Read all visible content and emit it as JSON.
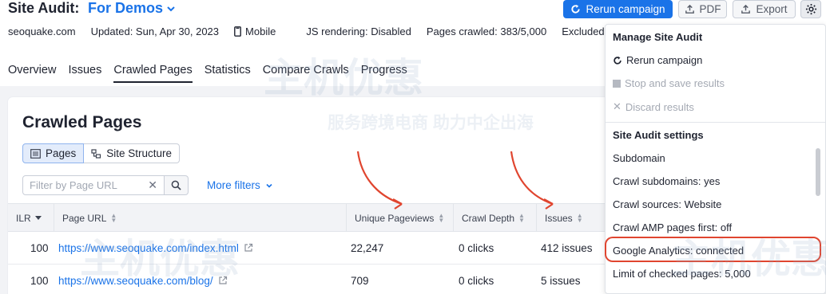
{
  "header": {
    "title": "Site Audit:",
    "project": "For Demos",
    "rerun_label": "Rerun campaign",
    "pdf_label": "PDF",
    "export_label": "Export"
  },
  "meta": {
    "domain": "seoquake.com",
    "updated": "Updated: Sun, Apr 30, 2023",
    "device": "Mobile",
    "js_rendering": "JS rendering: Disabled",
    "pages_crawled": "Pages crawled: 383/5,000",
    "excluded": "Excluded"
  },
  "tabs": [
    {
      "label": "Overview"
    },
    {
      "label": "Issues"
    },
    {
      "label": "Crawled Pages"
    },
    {
      "label": "Statistics"
    },
    {
      "label": "Compare Crawls"
    },
    {
      "label": "Progress"
    }
  ],
  "panel": {
    "title": "Crawled Pages",
    "seg_pages": "Pages",
    "seg_structure": "Site Structure",
    "filter_placeholder": "Filter by Page URL",
    "more_filters": "More filters"
  },
  "table": {
    "headers": [
      "ILR",
      "Page URL",
      "Unique Pageviews",
      "Crawl Depth",
      "Issues"
    ],
    "rows": [
      {
        "ilr": "100",
        "url": "https://www.seoquake.com/index.html",
        "pageviews": "22,247",
        "depth": "0 clicks",
        "issues": "412 issues"
      },
      {
        "ilr": "100",
        "url": "https://www.seoquake.com/blog/",
        "pageviews": "709",
        "depth": "0 clicks",
        "issues": "5 issues"
      }
    ]
  },
  "dropdown": {
    "manage_heading": "Manage Site Audit",
    "rerun": "Rerun campaign",
    "stop": "Stop and save results",
    "discard": "Discard results",
    "settings_heading": "Site Audit settings",
    "items": [
      "Subdomain",
      "Crawl subdomains: yes",
      "Crawl sources: Website",
      "Crawl AMP pages first: off",
      "Google Analytics: connected",
      "Limit of checked pages: 5,000"
    ]
  },
  "watermark": {
    "text1": "主机优惠",
    "text2": "服务跨境电商 助力中企出海"
  },
  "colors": {
    "accent": "#1a73e8",
    "annotation": "#e0452f"
  }
}
